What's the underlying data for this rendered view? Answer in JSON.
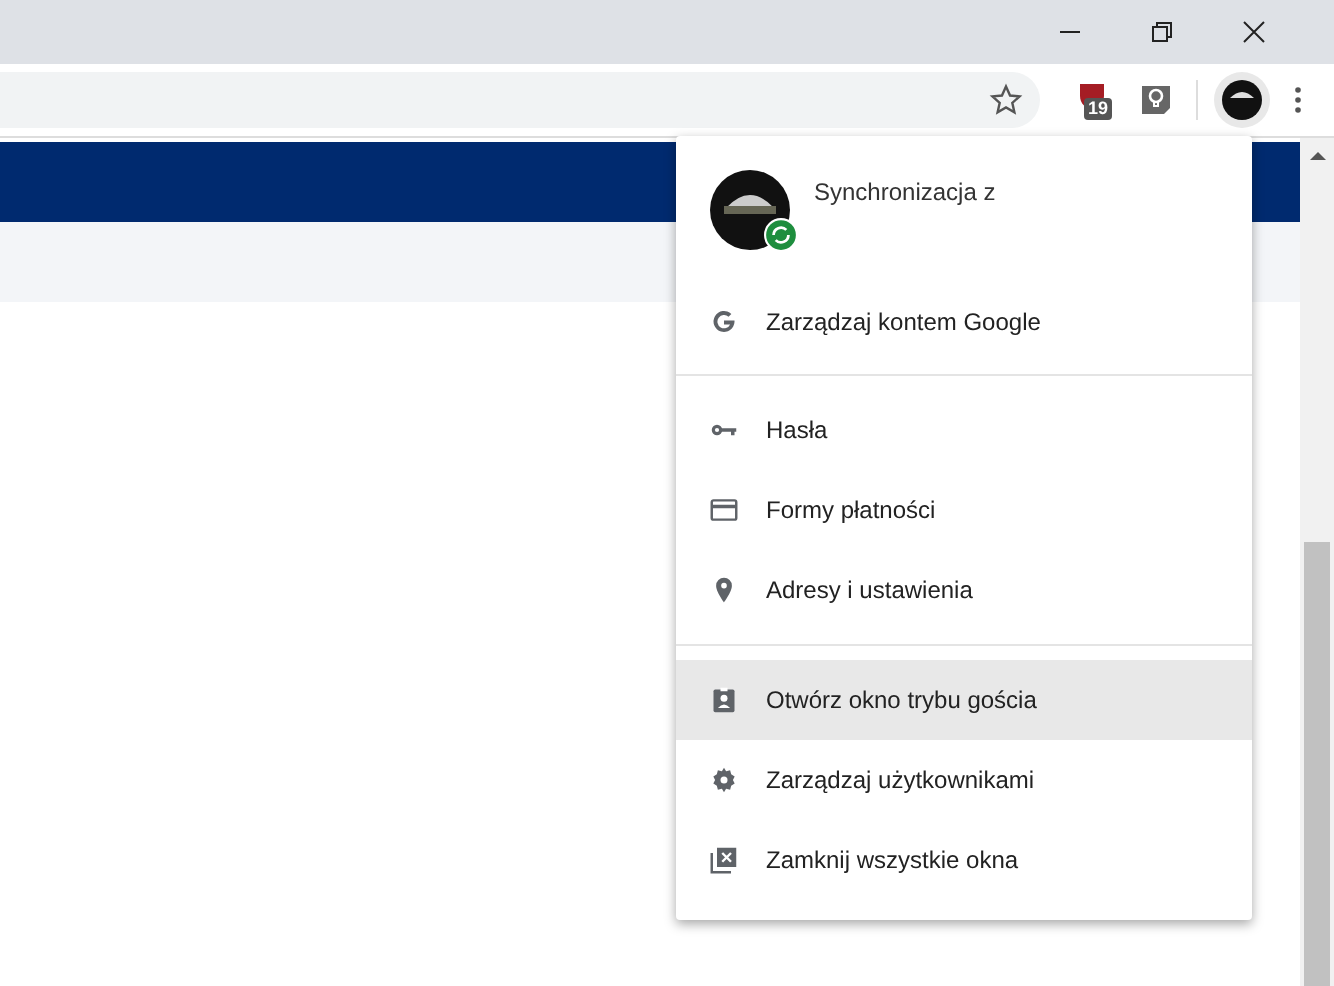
{
  "toolbar": {
    "extension_badge": "19"
  },
  "profile_menu": {
    "sync_text": "Synchronizacja z",
    "sections": [
      {
        "items": [
          {
            "label": "Zarządzaj kontem Google",
            "kind": "google",
            "selected": false
          }
        ]
      },
      {
        "items": [
          {
            "label": "Hasła",
            "kind": "key",
            "selected": false
          },
          {
            "label": "Formy płatności",
            "kind": "card",
            "selected": false
          },
          {
            "label": "Adresy i ustawienia",
            "kind": "pin",
            "selected": false
          }
        ]
      },
      {
        "items": [
          {
            "label": "Otwórz okno trybu gościa",
            "kind": "guest",
            "selected": true
          },
          {
            "label": "Zarządzaj użytkownikami",
            "kind": "gear",
            "selected": false
          },
          {
            "label": "Zamknij wszystkie okna",
            "kind": "close",
            "selected": false
          }
        ]
      }
    ]
  }
}
